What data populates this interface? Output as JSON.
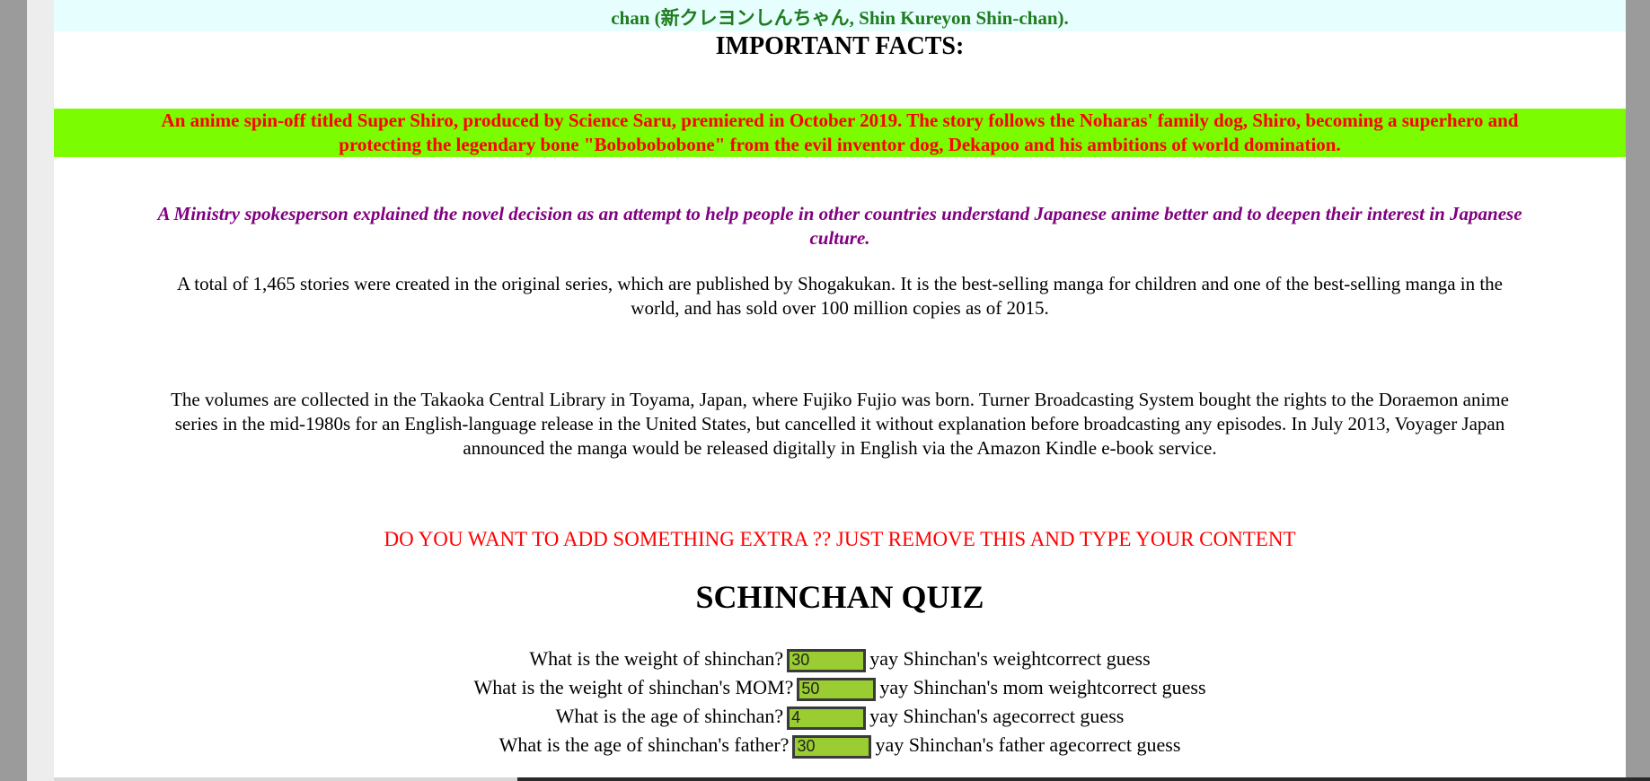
{
  "top_strip": {
    "text": "chan (新クレヨンしんちゃん, Shin Kureyon Shin-chan)."
  },
  "facts_heading": "IMPORTANT FACTS:",
  "green_box": {
    "line1": "An anime spin-off titled Super Shiro, produced by Science Saru, premiered in October 2019. The story follows the Noharas' family dog, Shiro, becoming a superhero and",
    "line2": "protecting the legendary bone \"Bobobobobone\" from the evil inventor dog, Dekapoo and his ambitions of world domination."
  },
  "ministry": {
    "line1": "A Ministry spokesperson explained the novel decision as an attempt to help people in other countries understand Japanese anime better and to deepen their interest in Japanese",
    "line2": "culture."
  },
  "stories": {
    "line1": "A total of 1,465 stories were created in the original series, which are published by Shogakukan. It is the best-selling manga for children and one of the best-selling manga in the",
    "line2": "world, and has sold over 100 million copies as of 2015."
  },
  "volumes": {
    "line1": "The volumes are collected in the Takaoka Central Library in Toyama, Japan, where Fujiko Fujio was born. Turner Broadcasting System bought the rights to the Doraemon anime",
    "line2": "series in the mid-1980s for an English-language release in the United States, but cancelled it without explanation before broadcasting any episodes. In July 2013, Voyager Japan",
    "line3": "announced the manga would be released digitally in English via the Amazon Kindle e-book service."
  },
  "extra_notice": "DO YOU WANT TO ADD SOMETHING EXTRA ?? JUST REMOVE THIS AND TYPE YOUR CONTENT",
  "quiz": {
    "title": "SCHINCHAN QUIZ",
    "rows": [
      {
        "question": "What is the weight of shinchan?",
        "value": "30",
        "feedback": "yay Shinchan's weightcorrect guess"
      },
      {
        "question": "What is the weight of shinchan's MOM?",
        "value": "50",
        "feedback": "yay Shinchan's mom weightcorrect guess"
      },
      {
        "question": "What is the age of shinchan?",
        "value": "4",
        "feedback": "yay Shinchan's agecorrect guess"
      },
      {
        "question": "What is the age of shinchan's father?",
        "value": "30",
        "feedback": "yay Shinchan's father agecorrect guess"
      }
    ]
  },
  "colors": {
    "top_strip_bg": "#e6fefe",
    "top_strip_text": "#1f7d1f",
    "green_box_bg": "#7cfc00",
    "green_box_text": "#ff0000",
    "ministry_text": "#800080",
    "extra_notice_text": "#ff0000",
    "quiz_input_bg": "#9acd32"
  }
}
